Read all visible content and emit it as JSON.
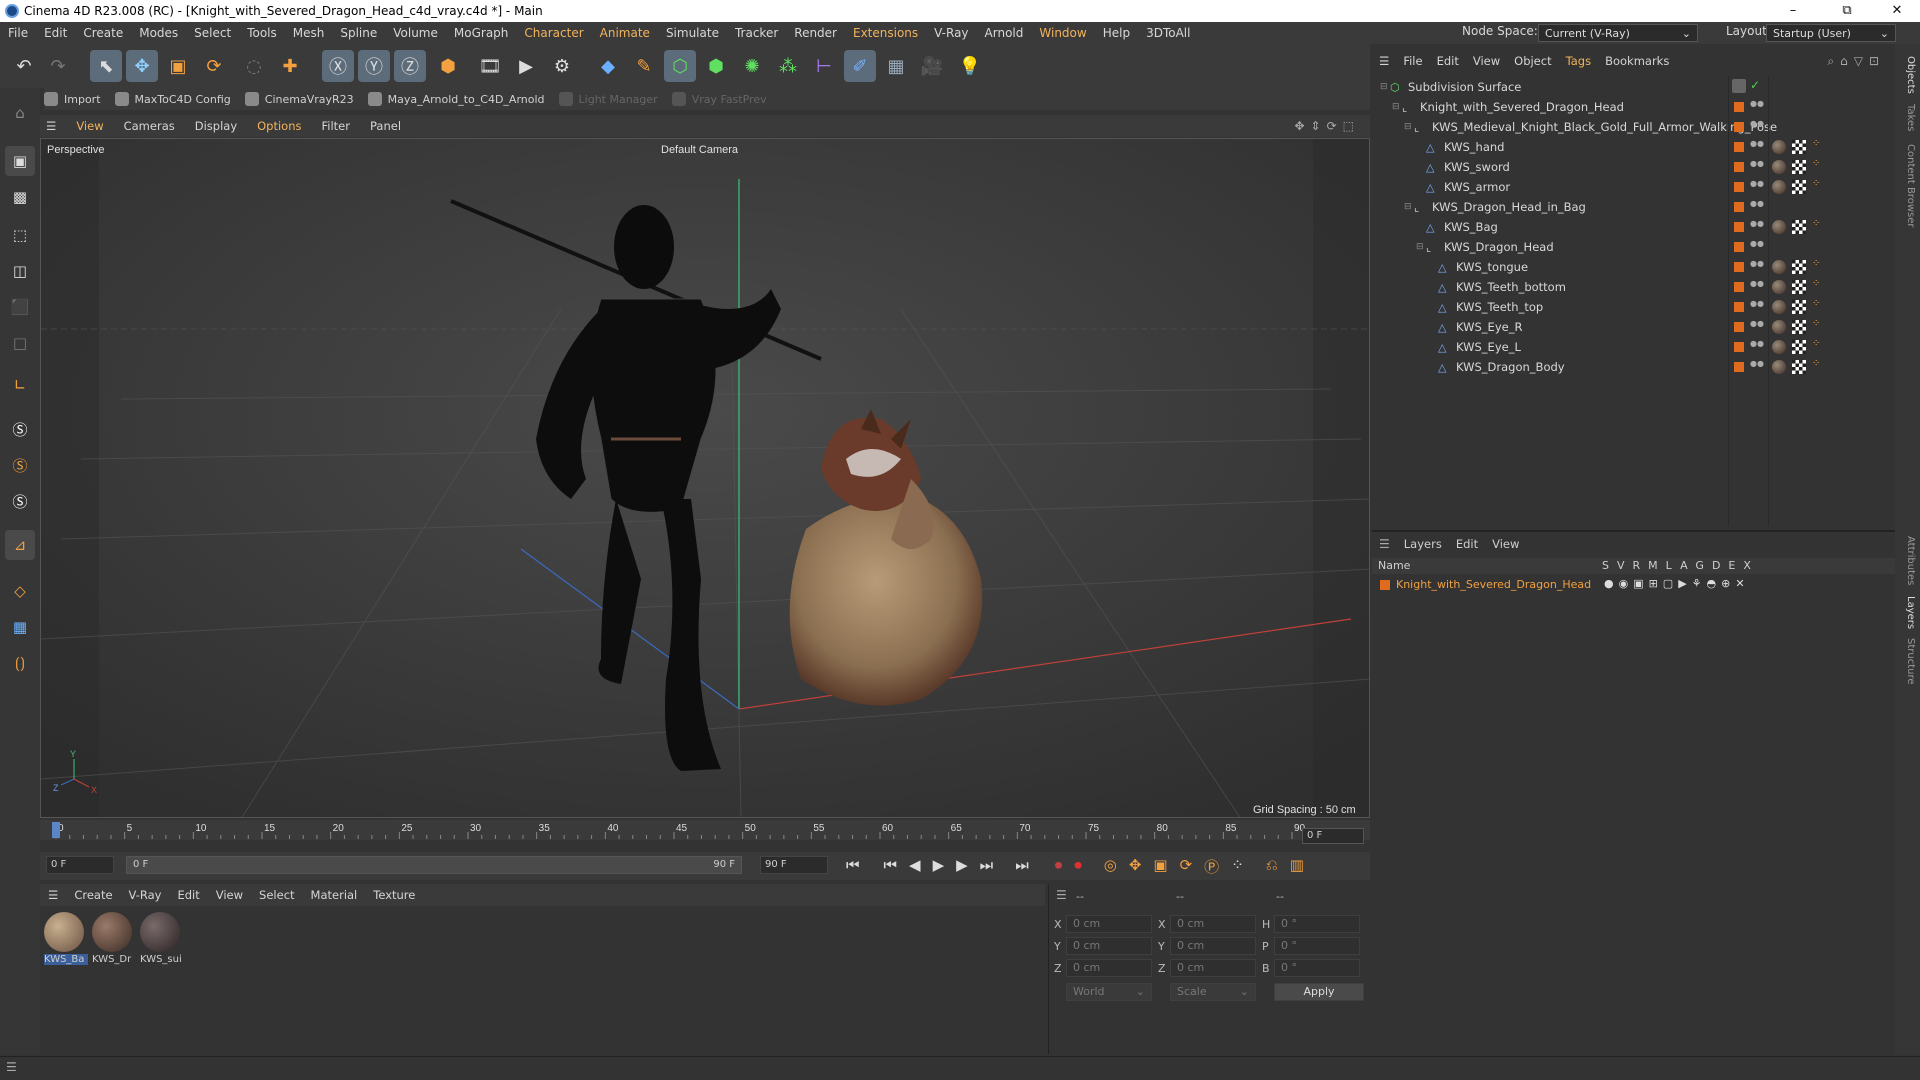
{
  "window": {
    "title": "Cinema 4D R23.008 (RC) - [Knight_with_Severed_Dragon_Head_c4d_vray.c4d *] - Main",
    "minimize": "–",
    "restore": "⧉",
    "close": "✕"
  },
  "menubar": {
    "items": [
      "File",
      "Edit",
      "Create",
      "Modes",
      "Select",
      "Tools",
      "Mesh",
      "Spline",
      "Volume",
      "MoGraph",
      "Character",
      "Animate",
      "Simulate",
      "Tracker",
      "Render",
      "Extensions",
      "V-Ray",
      "Arnold",
      "Window",
      "Help",
      "3DToAll"
    ],
    "node_space_label": "Node Space:",
    "node_space_value": "Current (V-Ray)",
    "layout_label": "Layout:",
    "layout_value": "Startup (User)"
  },
  "pluginbar": {
    "items": [
      "Import",
      "MaxToC4D Config",
      "CinemaVrayR23",
      "Maya_Arnold_to_C4D_Arnold",
      "Light Manager",
      "Vray FastPrev"
    ]
  },
  "viewport": {
    "menu": [
      "View",
      "Cameras",
      "Display",
      "Options",
      "Filter",
      "Panel"
    ],
    "label": "Perspective",
    "camera": "Default Camera",
    "grid_spacing": "Grid Spacing : 50 cm"
  },
  "timeline": {
    "ticks": [
      "0",
      "5",
      "10",
      "15",
      "20",
      "25",
      "30",
      "35",
      "40",
      "45",
      "50",
      "55",
      "60",
      "65",
      "70",
      "75",
      "80",
      "85",
      "90"
    ],
    "current_frame": "0 F"
  },
  "transport": {
    "start": "0 F",
    "range_start": "0 F",
    "range_end": "90 F",
    "end": "90 F"
  },
  "material_manager": {
    "menu": [
      "Create",
      "V-Ray",
      "Edit",
      "View",
      "Select",
      "Material",
      "Texture"
    ],
    "materials": [
      "KWS_Ba",
      "KWS_Dr",
      "KWS_sui"
    ]
  },
  "coords": {
    "headers": [
      "--",
      "--",
      "--"
    ],
    "rows": [
      {
        "a": "X",
        "av": "0 cm",
        "b": "X",
        "bv": "0 cm",
        "c": "H",
        "cv": "0 °"
      },
      {
        "a": "Y",
        "av": "0 cm",
        "b": "Y",
        "bv": "0 cm",
        "c": "P",
        "cv": "0 °"
      },
      {
        "a": "Z",
        "av": "0 cm",
        "b": "Z",
        "bv": "0 cm",
        "c": "B",
        "cv": "0 °"
      }
    ],
    "world": "World",
    "scale": "Scale",
    "apply": "Apply"
  },
  "object_manager": {
    "menu": [
      "File",
      "Edit",
      "View",
      "Object",
      "Tags",
      "Bookmarks"
    ],
    "objects": [
      {
        "name": "Subdivision Surface",
        "indent": 0
      },
      {
        "name": "Knight_with_Severed_Dragon_Head",
        "indent": 1
      },
      {
        "name": "KWS_Medieval_Knight_Black_Gold_Full_Armor_Walking_Pose",
        "indent": 2
      },
      {
        "name": "KWS_hand",
        "indent": 3
      },
      {
        "name": "KWS_sword",
        "indent": 3
      },
      {
        "name": "KWS_armor",
        "indent": 3
      },
      {
        "name": "KWS_Dragon_Head_in_Bag",
        "indent": 2
      },
      {
        "name": "KWS_Bag",
        "indent": 3
      },
      {
        "name": "KWS_Dragon_Head",
        "indent": 3
      },
      {
        "name": "KWS_tongue",
        "indent": 4
      },
      {
        "name": "KWS_Teeth_bottom",
        "indent": 4
      },
      {
        "name": "KWS_Teeth_top",
        "indent": 4
      },
      {
        "name": "KWS_Eye_R",
        "indent": 4
      },
      {
        "name": "KWS_Eye_L",
        "indent": 4
      },
      {
        "name": "KWS_Dragon_Body",
        "indent": 4
      }
    ]
  },
  "layers": {
    "menu": [
      "Layers",
      "Edit",
      "View"
    ],
    "col_name": "Name",
    "flags": [
      "S",
      "V",
      "R",
      "M",
      "L",
      "A",
      "G",
      "D",
      "E",
      "X"
    ],
    "layer_name": "Knight_with_Severed_Dragon_Head"
  },
  "right_tabs": [
    "Objects",
    "Takes",
    "Content Browser",
    "Attributes",
    "Layers",
    "Structure"
  ],
  "axis_labels": {
    "y": "Y",
    "z": "Z",
    "x": "X"
  }
}
